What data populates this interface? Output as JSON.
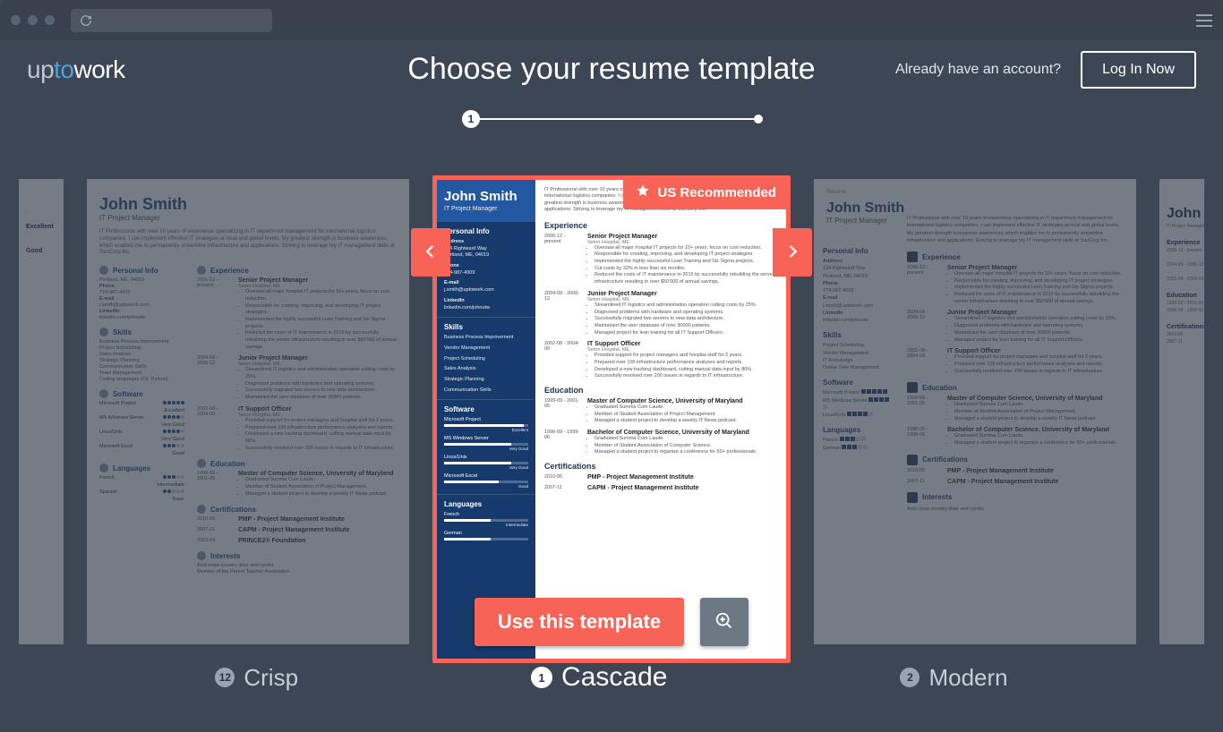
{
  "header": {
    "logo_parts": [
      "up",
      "to",
      "work"
    ],
    "title": "Choose your resume template",
    "have_account": "Already have an account?",
    "login": "Log In Now",
    "step": "1"
  },
  "templates": {
    "left": {
      "num": "12",
      "name": "Crisp"
    },
    "center": {
      "num": "1",
      "name": "Cascade"
    },
    "right": {
      "num": "2",
      "name": "Modern"
    }
  },
  "badge": "US Recommended",
  "use_button": "Use this template",
  "resume": {
    "name": "John Smith",
    "role": "IT Project Manager",
    "summary": "IT Professional with over 10 years of experience specializing in IT department management for international logistics companies. I can implement effective IT strategies at local and global levels. My greatest strength is business awareness, which enables me to permanently streamline infrastructure and applications. Striving to leverage my IT management skills at SanCorp Inc.",
    "personal": {
      "title": "Personal Info",
      "address_label": "Address",
      "address1": "134 Rightward Way",
      "address2": "Portland, ME, 04019",
      "phone_label": "Phone",
      "phone": "774-987-4009",
      "email_label": "E-mail",
      "email": "j.smith@uptowork.com",
      "linkedin_label": "LinkedIn",
      "linkedin": "linkedin.com/johnutw"
    },
    "skills": {
      "title": "Skills",
      "items": [
        "Business Process Improvement",
        "Vendor Management",
        "Project Scheduling",
        "Sales Analysis",
        "Strategic Planning",
        "Communication Skills",
        "Team Management",
        "Coding languages (C#, Python)"
      ]
    },
    "software": {
      "title": "Software",
      "items": [
        {
          "name": "Microsoft Project",
          "level": "Excellent",
          "pct": 95
        },
        {
          "name": "MS Windows Server",
          "level": "Very Good",
          "pct": 80
        },
        {
          "name": "Linux/Unix",
          "level": "Very Good",
          "pct": 80
        },
        {
          "name": "Microsoft Excel",
          "level": "Good",
          "pct": 65
        }
      ]
    },
    "languages": {
      "title": "Languages",
      "items": [
        {
          "name": "French",
          "level": "Intermediate"
        },
        {
          "name": "German",
          "level": "Intermediate"
        },
        {
          "name": "Spanish",
          "level": "Basic"
        }
      ]
    },
    "experience": {
      "title": "Experience",
      "jobs": [
        {
          "dates": "2006-12 - present",
          "title": "Senior Project Manager",
          "company": "Seton Hospital, ME",
          "bullets": [
            "Oversaw all major hospital IT projects for 10+ years, focus on cost reduction.",
            "Responsible for creating, improving, and developing IT project strategies.",
            "Implemented the highly successful Lean Training and Six Sigma projects.",
            "Cut costs by 32% in less than six months.",
            "Reduced the costs of IT maintenance in 2015 by successfully rebuilding the server infrastructure resulting in over $50'000 of annual savings."
          ]
        },
        {
          "dates": "2004-09 - 2006-12",
          "title": "Junior Project Manager",
          "company": "Seton Hospital, ME",
          "bullets": [
            "Streamlined IT logistics and administration operation cutting costs by 25%.",
            "Diagnosed problems with hardware and operating systems.",
            "Successfully migrated two servers to new data architecture.",
            "Maintained the user database of over 30000 patients.",
            "Managed project for lean training for all IT Support Officers."
          ]
        },
        {
          "dates": "2002-08 - 2004-09",
          "title": "IT Support Officer",
          "company": "Seton Hospital, ME",
          "bullets": [
            "Provided support for project managers and hospital staff for 2 years.",
            "Prepared over 100 infrastructure performance analyses and reports.",
            "Developed a new tracking dashboard, cutting manual data input by 80%.",
            "Successfully resolved over 200 issues in regards to IT infrastructure."
          ]
        }
      ]
    },
    "education": {
      "title": "Education",
      "items": [
        {
          "dates": "1999-09 - 2001-05",
          "title": "Master of Computer Science, University of Maryland",
          "bullets": [
            "Graduated Summa Cum Laude.",
            "Member of Student Association of Project Management.",
            "Managed a student project to develop a weekly IT News podcast."
          ]
        },
        {
          "dates": "1996-09 - 1999-06",
          "title": "Bachelor of Computer Science, University of Maryland",
          "bullets": [
            "Graduated Summa Cum Laude.",
            "Member of Student Association of Computer Science.",
            "Managed a student project to organize a conference for 50+ professionals."
          ]
        }
      ]
    },
    "certifications": {
      "title": "Certifications",
      "items": [
        {
          "dates": "2010-05",
          "name": "PMP - Project Management Institute"
        },
        {
          "dates": "2007-11",
          "name": "CAPM - Project Management Institute"
        },
        {
          "dates": "2003-04",
          "name": "PRINCE2® Foundation"
        }
      ]
    },
    "interests": {
      "title": "Interests",
      "items": [
        "Avid cross country skier and cyclist.",
        "Member of the Parent Teacher Association."
      ]
    },
    "modern_extra": {
      "resume_label": "Resume",
      "it_knowledge": "IT Knowledge",
      "time_mgmt": "Online Time Management"
    }
  }
}
